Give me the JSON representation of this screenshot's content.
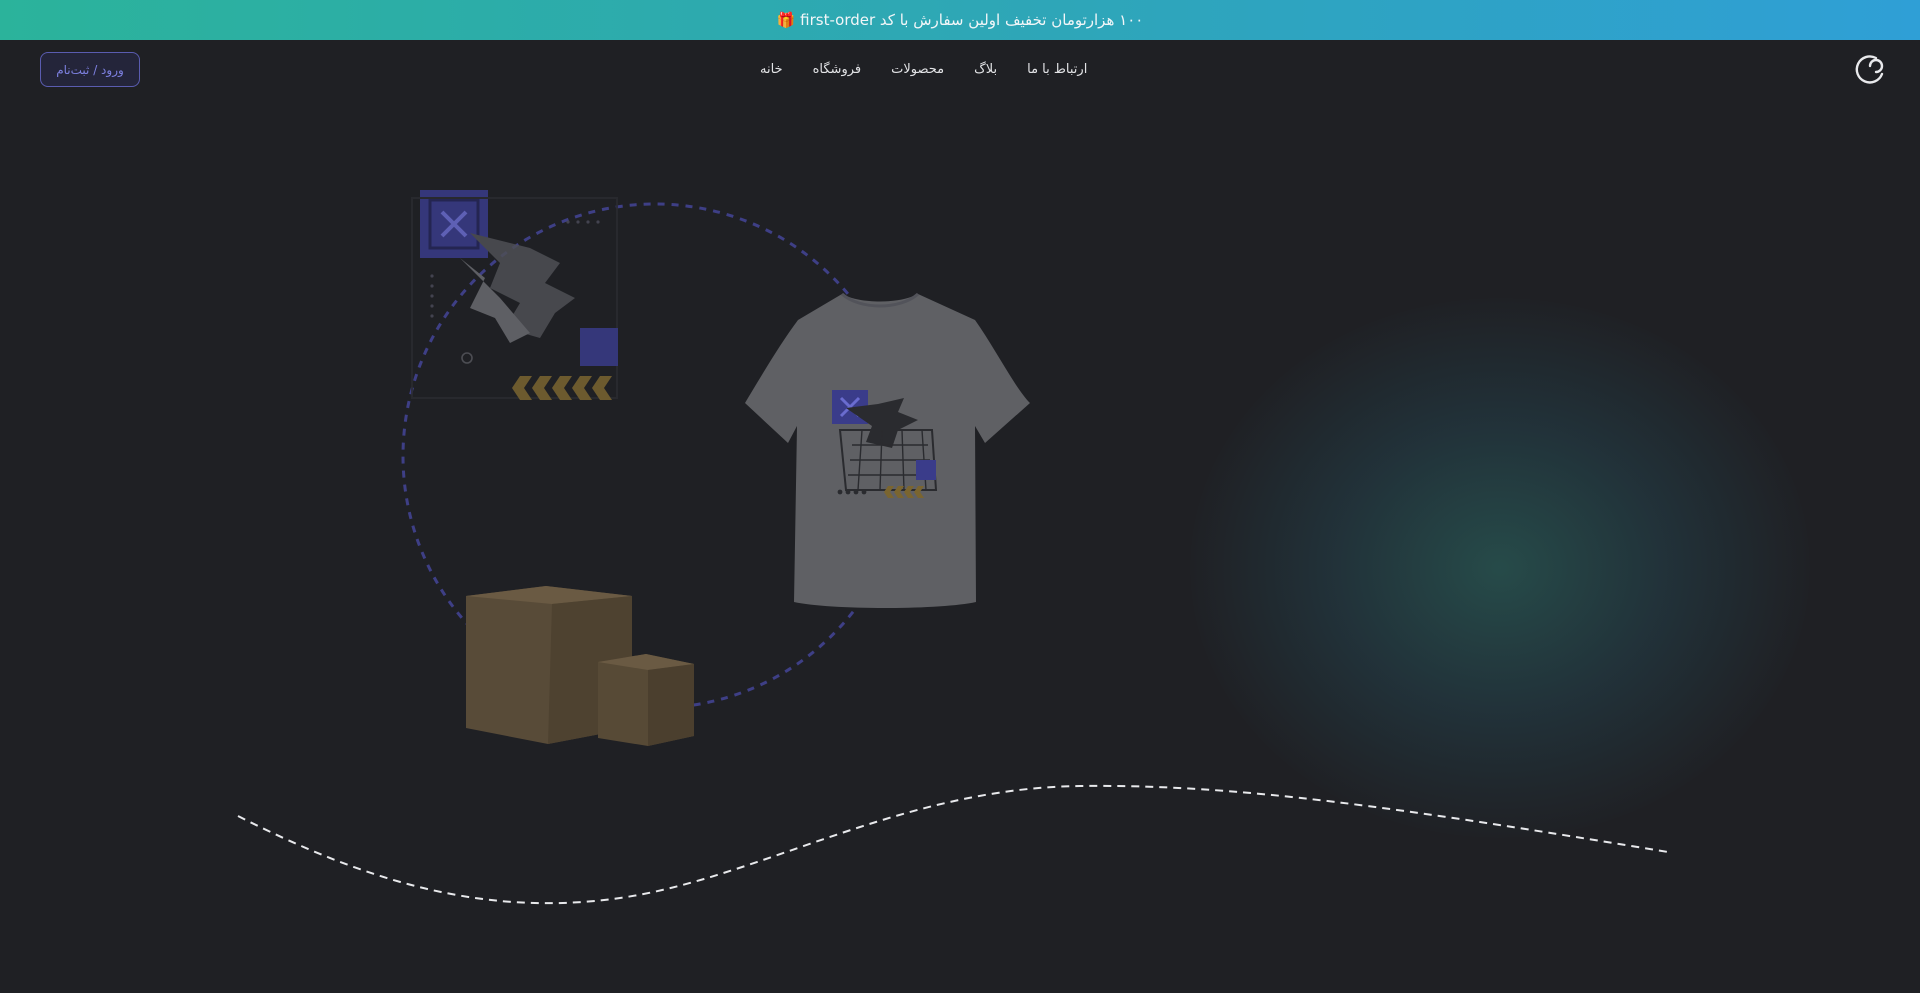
{
  "promo": {
    "text": "۱۰۰ هزارتومان تخفیف اولین سفارش با کد first-order 🎁"
  },
  "header": {
    "login_label": "ورود / ثبت‌نام",
    "nav": [
      {
        "label": "خانه"
      },
      {
        "label": "فروشگاه"
      },
      {
        "label": "محصولات"
      },
      {
        "label": "بلاگ"
      },
      {
        "label": "ارتباط با ما"
      }
    ],
    "logo_icon": "brand-logo-icon"
  },
  "hero": {
    "illustration_items": [
      "tshirt-illustration",
      "sticker-graphic",
      "shipping-boxes",
      "dashed-orbit",
      "wavy-dashed-line"
    ]
  },
  "colors": {
    "promo_gradient_start": "#2bb39b",
    "promo_gradient_end": "#2f9fd6",
    "background": "#1f2024",
    "accent_purple": "#5a5cb0",
    "glow_teal": "#2c6e68"
  }
}
